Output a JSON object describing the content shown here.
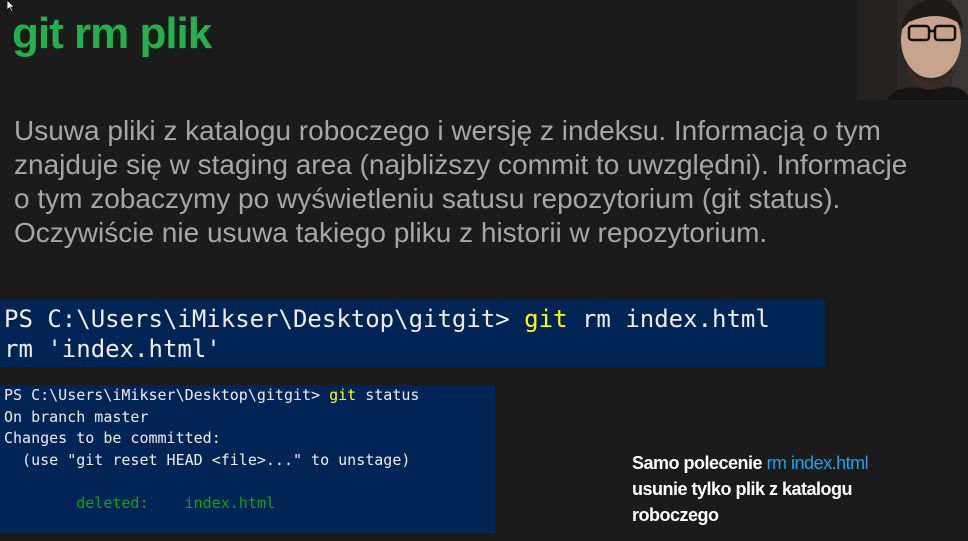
{
  "slide": {
    "title": "git rm plik",
    "description_lines": [
      "Usuwa pliki z katalogu roboczego i wersję z indeksu. Informacją o tym",
      "znajduje się w staging area (najbliższy commit to uwzględni). Informacje",
      "o tym zobaczymy po wyświetleniu satusu repozytorium (git status).",
      "Oczywiście nie usuwa takiego pliku z historii w repozytorium."
    ]
  },
  "terminal_large": {
    "prompt": "PS C:\\Users\\iMikser\\Desktop\\gitgit> ",
    "command": "git",
    "args": " rm index.html",
    "output": "rm 'index.html'"
  },
  "terminal_small": {
    "prompt": "PS C:\\Users\\iMikser\\Desktop\\gitgit> ",
    "command": "git",
    "args": " status",
    "line_branch": "On branch master",
    "line_changes": "Changes to be committed:",
    "line_hint": "  (use \"git reset HEAD <file>...\" to unstage)",
    "deleted_label": "        deleted:    index.html"
  },
  "note": {
    "prefix": "Samo polecenie ",
    "command": "rm index.html",
    "line2": "usunie tylko plik z katalogu",
    "line3": "roboczego"
  },
  "colors": {
    "title": "#22b14c",
    "terminal_bg": "#012456",
    "command_yellow": "#ffff00",
    "deleted_green": "#13a10e",
    "note_command_blue": "#1da1e8"
  },
  "icons": {
    "cursor": "mouse-pointer-icon",
    "webcam": "webcam-presenter"
  }
}
